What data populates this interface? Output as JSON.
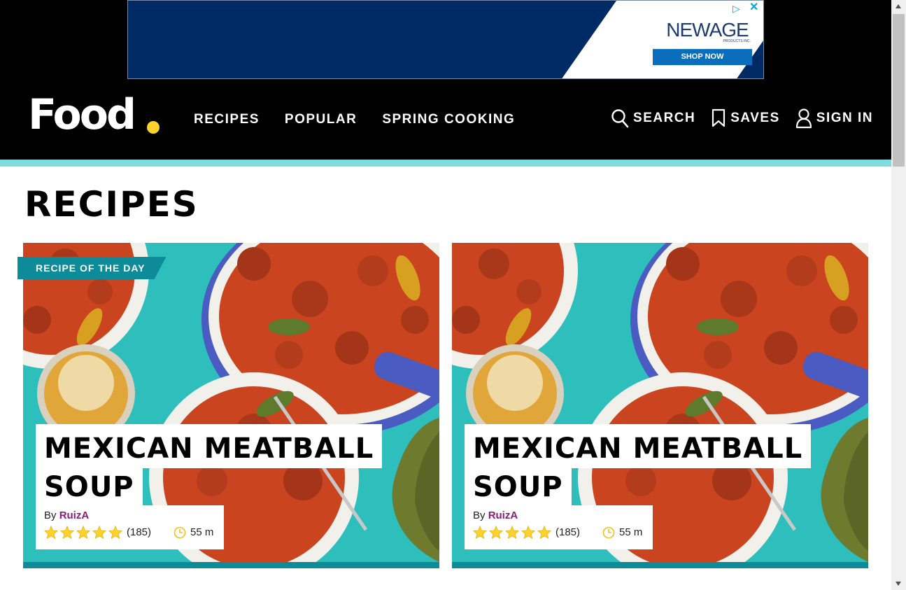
{
  "ad": {
    "brand": "NEWAGE",
    "brand_sub": "PRODUCTS INC.",
    "cta": "SHOP NOW"
  },
  "header": {
    "logo": "Food",
    "nav": [
      "RECIPES",
      "POPULAR",
      "SPRING COOKING"
    ],
    "search_label": "SEARCH",
    "saves_label": "SAVES",
    "signin_label": "SIGN IN"
  },
  "page": {
    "title": "RECIPES"
  },
  "cards": [
    {
      "badge": "RECIPE OF THE DAY",
      "title_line1": "MEXICAN MEATBALL",
      "title_line2": "SOUP",
      "by_prefix": "By",
      "author": "RuizA",
      "rating": 5,
      "reviews": "(185)",
      "time": "55 m"
    },
    {
      "badge": "",
      "title_line1": "MEXICAN MEATBALL",
      "title_line2": "SOUP",
      "by_prefix": "By",
      "author": "RuizA",
      "rating": 5,
      "reviews": "(185)",
      "time": "55 m"
    }
  ],
  "colors": {
    "accent_teal": "#0e8b99",
    "strip_teal": "#7fdcdc",
    "star_yellow": "#fdd22a",
    "author_purple": "#8b1b7c",
    "logo_dot": "#fdd22a"
  }
}
